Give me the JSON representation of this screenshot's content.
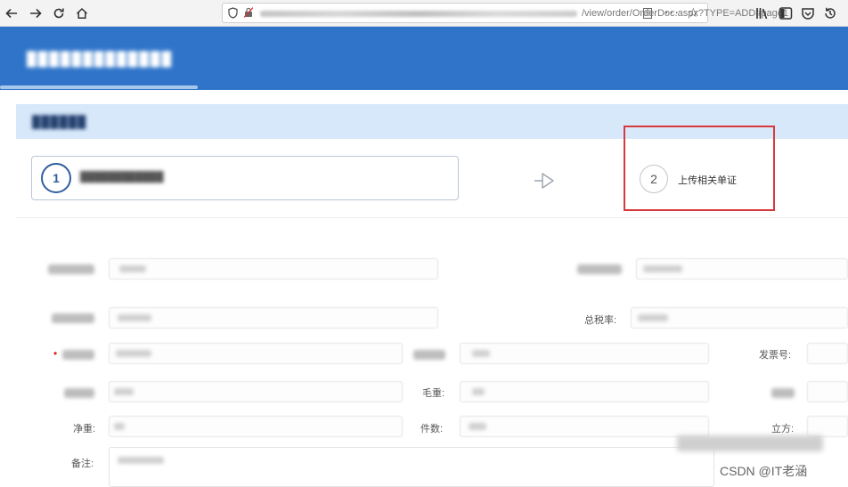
{
  "browser": {
    "url_path": "/view/order/OrderDoc.aspx?TYPE=ADD#page1",
    "more_glyph": "···",
    "star_glyph": "☆",
    "icons": [
      "back-icon",
      "forward-icon",
      "reload-icon",
      "home-icon",
      "library-icon",
      "sidebar-icon",
      "pocket-icon",
      "history-icon"
    ]
  },
  "steps": {
    "step1_number": "1",
    "step2_number": "2",
    "step2_label": "上传相关单证",
    "arrow_icon": "arrow-right-outline-icon"
  },
  "form": {
    "tax_label": "总税率:",
    "invoice_label": "发票号:",
    "gross_label": "毛重:",
    "count_label": "件数:",
    "net_label": "净重:",
    "cube_label": "立方:",
    "note_label": "备注:"
  },
  "watermark": "CSDN @IT老涵",
  "colors": {
    "header_blue": "#2f74c9",
    "section_blue": "#d7e8fb",
    "highlight_red": "#d8393c",
    "step_blue": "#2f5e9c"
  }
}
